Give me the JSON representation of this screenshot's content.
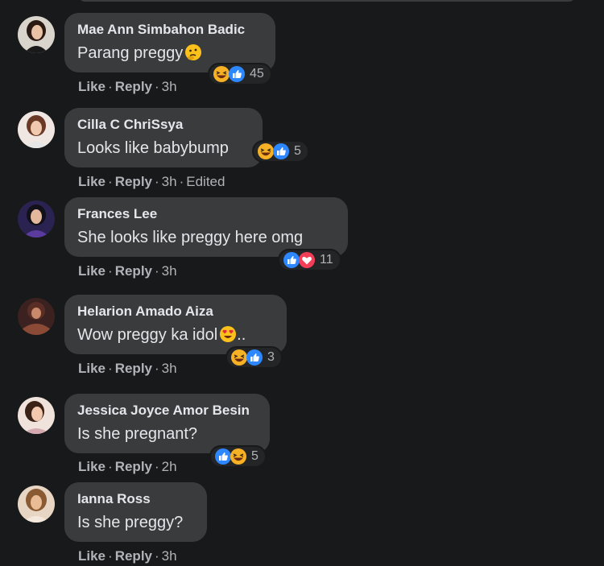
{
  "comments": [
    {
      "author": "Mae Ann Simbahon Badic",
      "text": "Parang preggy",
      "emoji": "thinking-face",
      "reactions": [
        "haha",
        "like"
      ],
      "count": "45",
      "like": "Like",
      "reply": "Reply",
      "time": "3h",
      "edited": ""
    },
    {
      "author": "Cilla C ChriSsya",
      "text": "Looks like babybump",
      "emoji": "",
      "reactions": [
        "haha",
        "like"
      ],
      "count": "5",
      "like": "Like",
      "reply": "Reply",
      "time": "3h",
      "edited": "Edited"
    },
    {
      "author": "Frances Lee",
      "text": "She looks like preggy here omg",
      "emoji": "",
      "reactions": [
        "like",
        "love"
      ],
      "count": "11",
      "like": "Like",
      "reply": "Reply",
      "time": "3h",
      "edited": ""
    },
    {
      "author": "Helarion Amado Aiza",
      "text": "Wow preggy ka idol",
      "emoji": "heart-eyes-face",
      "text_suffix": "..",
      "reactions": [
        "haha",
        "like"
      ],
      "count": "3",
      "like": "Like",
      "reply": "Reply",
      "time": "3h",
      "edited": ""
    },
    {
      "author": "Jessica Joyce Amor Besin",
      "text": "Is she pregnant?",
      "emoji": "",
      "reactions": [
        "like",
        "haha"
      ],
      "count": "5",
      "like": "Like",
      "reply": "Reply",
      "time": "2h",
      "edited": ""
    },
    {
      "author": "Ianna Ross",
      "text": "Is she preggy?",
      "emoji": "",
      "reactions": [],
      "count": "",
      "like": "Like",
      "reply": "Reply",
      "time": "3h",
      "edited": ""
    }
  ],
  "colors": {
    "like": "#2d88ff",
    "love": "#f33e58",
    "haha": "#f7b125"
  }
}
